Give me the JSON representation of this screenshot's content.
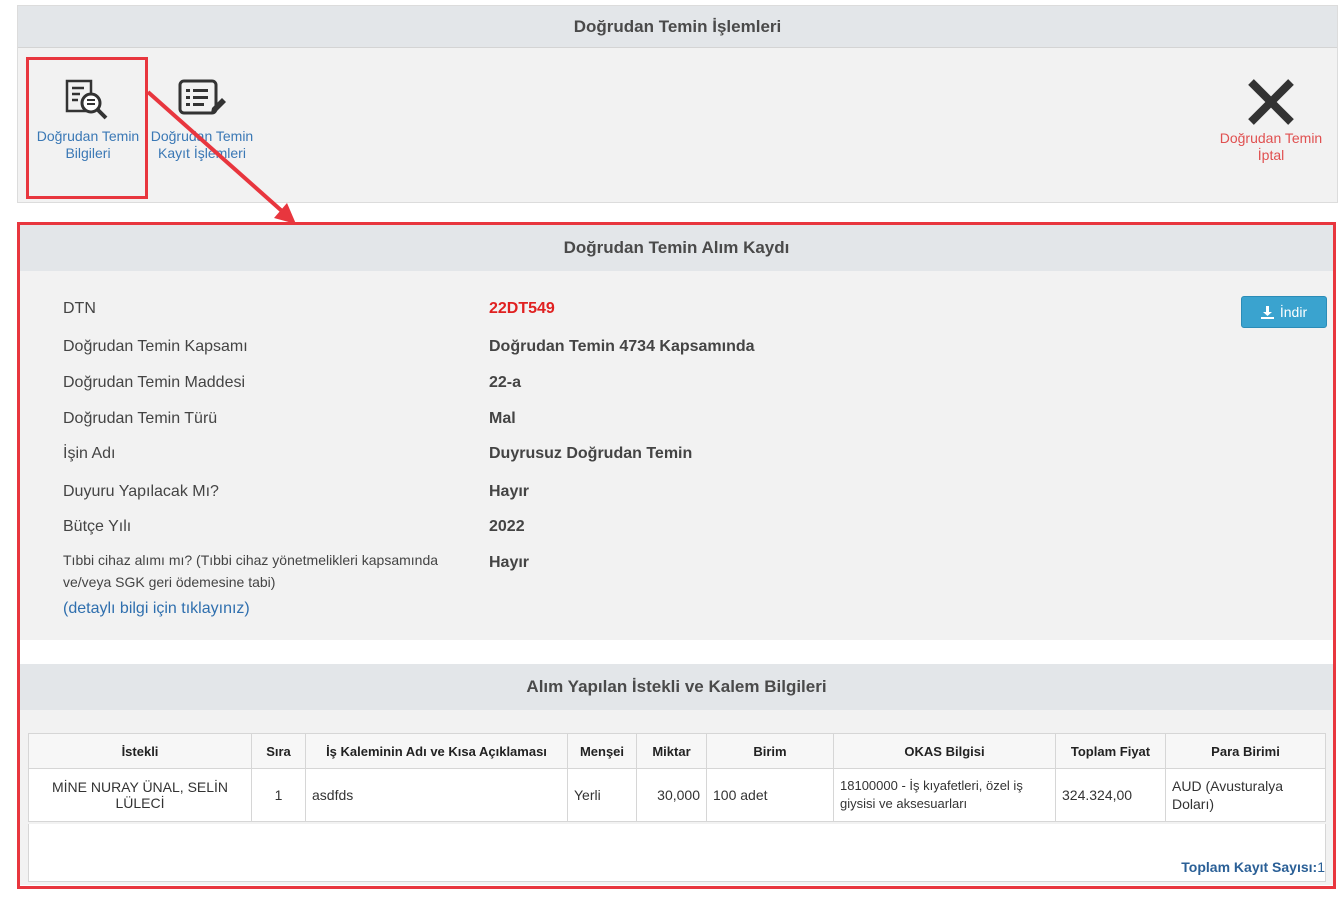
{
  "top": {
    "title": "Doğrudan Temin İşlemleri",
    "tools": [
      {
        "label_line1": "Doğrudan Temin",
        "label_line2": "Bilgileri",
        "icon": "document-search-icon"
      },
      {
        "label_line1": "Doğrudan Temin",
        "label_line2": "Kayıt İşlemleri",
        "icon": "list-edit-icon"
      },
      {
        "label_line1": "Doğrudan Temin",
        "label_line2": "İptal",
        "icon": "close-icon"
      }
    ]
  },
  "record": {
    "title": "Doğrudan Temin Alım Kaydı",
    "download_label": "İndir",
    "fields": [
      {
        "label": "DTN",
        "value": "22DT549"
      },
      {
        "label": "Doğrudan Temin Kapsamı",
        "value": "Doğrudan Temin 4734 Kapsamında"
      },
      {
        "label": "Doğrudan Temin Maddesi",
        "value": "22-a"
      },
      {
        "label": "Doğrudan Temin Türü",
        "value": "Mal"
      },
      {
        "label": "İşin Adı",
        "value": "Duyrusuz Doğrudan Temin"
      },
      {
        "label": "Duyuru Yapılacak Mı?",
        "value": "Hayır"
      },
      {
        "label": "Bütçe Yılı",
        "value": "2022"
      },
      {
        "label": "Tıbbi cihaz alımı mı? (Tıbbi cihaz yönetmelikleri kapsamında",
        "value": "Hayır"
      }
    ],
    "medical_label_line2": "ve/veya SGK geri ödemesine tabi)",
    "detail_link": "(detaylı bilgi için tıklayınız)"
  },
  "items": {
    "title": "Alım Yapılan İstekli ve Kalem Bilgileri",
    "columns": [
      "İstekli",
      "Sıra",
      "İş Kaleminin Adı ve Kısa Açıklaması",
      "Menşei",
      "Miktar",
      "Birim",
      "OKAS Bilgisi",
      "Toplam Fiyat",
      "Para Birimi"
    ],
    "rows": [
      [
        "MİNE NURAY ÜNAL, SELİN LÜLECİ",
        "1",
        "asdfds",
        "Yerli",
        "30,000",
        "100 adet",
        "18100000 - İş kıyafetleri, özel iş giysisi ve aksesuarları",
        "324.324,00",
        "AUD (Avusturalya Doları)"
      ]
    ],
    "total_label": "Toplam Kayıt Sayısı:",
    "total_count": "1"
  },
  "colors": {
    "highlight": "#e8363e",
    "dtn": "#e02020",
    "link": "#2f6fae",
    "button": "#3aa3cf"
  }
}
